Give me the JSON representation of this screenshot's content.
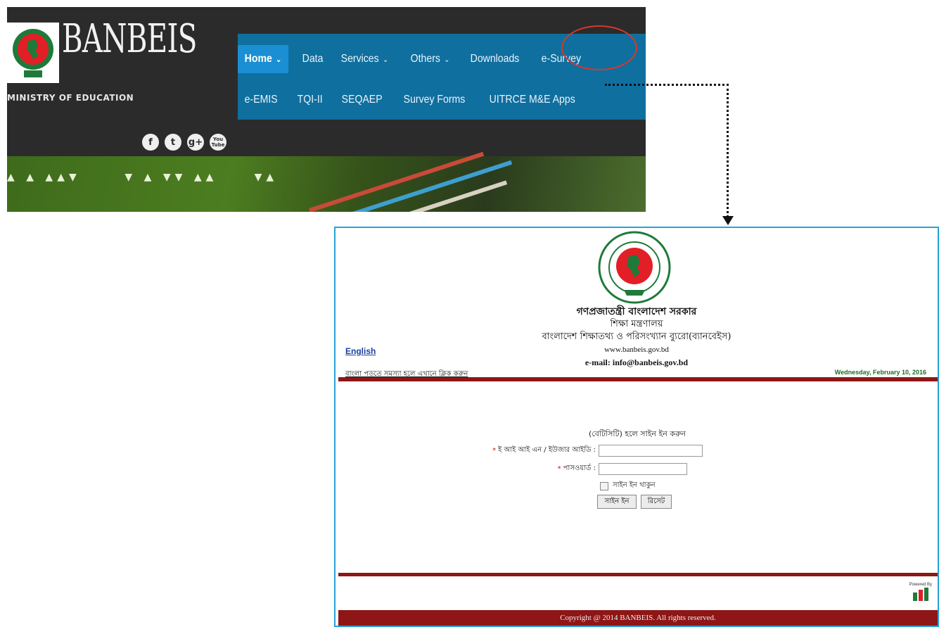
{
  "header": {
    "brand": "BANBEIS",
    "ministry": "MINISTRY OF EDUCATION",
    "nav_row1": [
      {
        "label": "Home",
        "chevron": true,
        "active": true
      },
      {
        "label": "Data",
        "chevron": false
      },
      {
        "label": "Services",
        "chevron": true
      },
      {
        "label": "Others",
        "chevron": true
      },
      {
        "label": "Downloads",
        "chevron": false
      },
      {
        "label": "e-Survey",
        "chevron": false
      }
    ],
    "nav_row2": [
      {
        "label": "e-EMIS"
      },
      {
        "label": "TQI-II"
      },
      {
        "label": "SEQAEP"
      },
      {
        "label": "Survey Forms"
      },
      {
        "label": "UITRCE M&E Apps"
      }
    ],
    "social": [
      "facebook-icon",
      "twitter-icon",
      "google-plus-icon",
      "youtube-icon"
    ],
    "social_glyphs": {
      "facebook": "f",
      "twitter": "t",
      "google_plus": "g+",
      "youtube": "You Tube"
    }
  },
  "login_page": {
    "org_line1": "গণপ্রজাতন্ত্রী বাংলাদেশ সরকার",
    "org_line2": "শিক্ষা মন্ত্রণালয়",
    "org_line3": "বাংলাদেশ শিক্ষাতথ্য ও পরিসংখ্যান ব্যুরো(ব্যানবেইস)",
    "website": "www.banbeis.gov.bd",
    "email": "e-mail: info@banbeis.gov.bd",
    "english_link": "English",
    "bangla_link": "বাংলা পড়তে সমস্যা হলে এখানে ক্লিক করুন",
    "date": "Wednesday, February 10, 2016",
    "login_title": "(বেটিসিটি) হলে সাইন ইন করুন",
    "field1_label": "ই আই আই এন / ইউজার আইডি :",
    "field2_label": "পাসওয়ার্ড :",
    "remember_label": "সাইন ইন থাকুন",
    "signin_button": "সাইন ইন",
    "reset_button": "রিসেট",
    "powered_by": "Powered By",
    "footer": "Copyright @ 2014 BANBEIS. All rights reserved."
  },
  "colors": {
    "nav_bg": "#0f6f9f",
    "nav_active": "#1b8fd3",
    "header_bg": "#2b2b2b",
    "footer_red": "#8e1616",
    "highlight_circle": "#d9362b",
    "frame_border": "#28a3d9"
  }
}
